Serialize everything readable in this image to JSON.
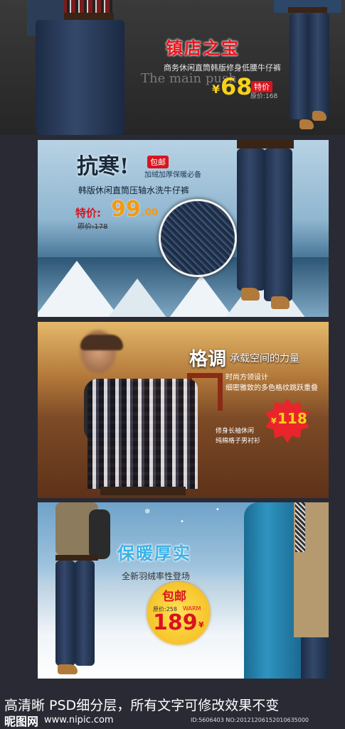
{
  "banner1": {
    "title": "镇店之宝",
    "subtitle": "商务休闲直筒韩版修身低腰牛仔裤",
    "script_text": "The main push",
    "currency": "¥",
    "price": "68",
    "special_label": "特价",
    "original_price": "原价:168"
  },
  "banner2": {
    "headline": "抗寒!",
    "free_shipping": "包邮",
    "tagline": "加绒加厚保暖必备",
    "product_name": "韩版休闲直筒压轴水洗牛仔裤",
    "special_price_label": "特价:",
    "price": "99",
    "price_decimal": ".00",
    "original_price": "原价:178"
  },
  "banner3": {
    "headline": "格调",
    "headline_suffix": "承载空间的力量",
    "line1": "时尚方领设计",
    "line2": "细密雅致的多色格纹跳跃重叠",
    "currency": "¥",
    "price": "118",
    "desc1": "修身长袖休闲",
    "desc2": "纯棉格子男衬衫"
  },
  "banner4": {
    "headline": "保暖厚实",
    "subtitle": "全新羽绒率性登场",
    "free_shipping": "包邮",
    "original_price": "原价:258",
    "warm_label": "WARM",
    "price": "189",
    "currency": "¥"
  },
  "footer": {
    "text": "高清晰 PSD细分层，所有文字可修改效果不变",
    "watermark_logo": "昵图网",
    "watermark_url": "www.nipic.com",
    "watermark_id": "ID:5606403 NO:20121206152010635000"
  },
  "colors": {
    "red": "#d8141e",
    "yellow": "#f7d21a",
    "background": "#2a2a35"
  }
}
